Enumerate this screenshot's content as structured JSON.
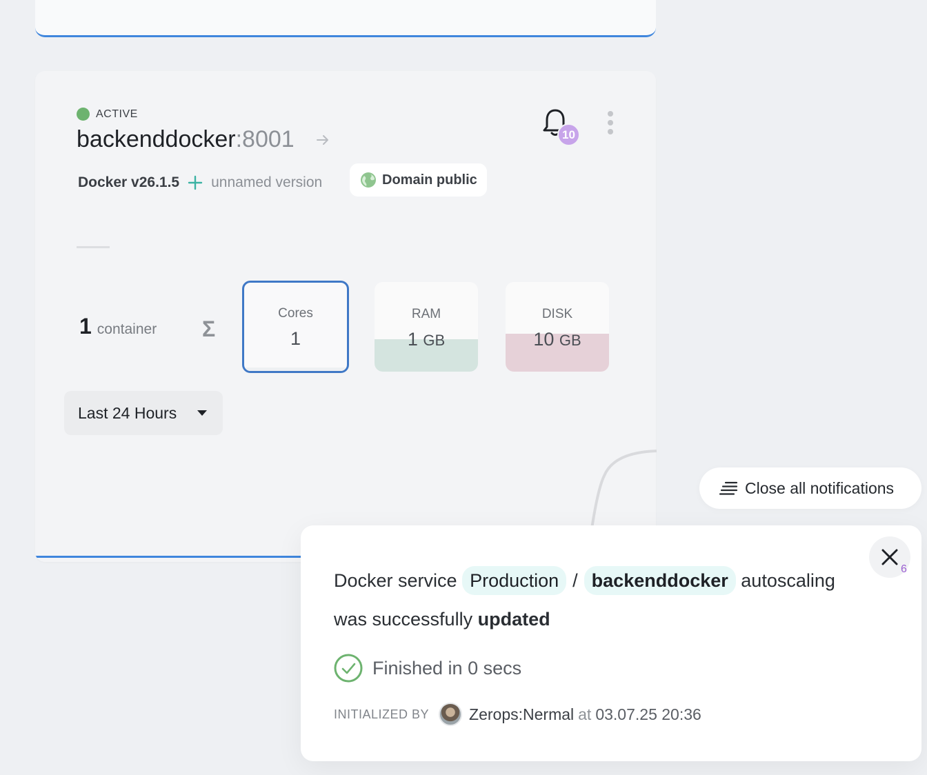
{
  "service": {
    "status": "ACTIVE",
    "name": "backenddocker",
    "port": ":8001",
    "version": "Docker v26.1.5",
    "version_sub": "unnamed version",
    "domain_chip": "Domain public",
    "notifications_count": "10",
    "container_count": "1",
    "container_label": "container",
    "sum_symbol": "Σ"
  },
  "resources": {
    "cores": {
      "label": "Cores",
      "value": "1"
    },
    "ram": {
      "label": "RAM",
      "value": "1",
      "unit": "GB",
      "fill_fraction": 0.36
    },
    "disk": {
      "label": "DISK",
      "value": "10",
      "unit": "GB",
      "fill_fraction": 0.42
    }
  },
  "time_range": {
    "selected": "Last 24 Hours"
  },
  "notifications_bar": {
    "close_all_label": "Close all notifications"
  },
  "notification": {
    "text_prefix": "Docker service",
    "project_tag": "Production",
    "separator": "/",
    "service_tag": "backenddocker",
    "text_middle": "autoscaling",
    "text_line2": "was successfully",
    "text_strong": "updated",
    "finished": "Finished in 0 secs",
    "initialized_label": "INITIALIZED BY",
    "user": "Zerops:Nermal",
    "at_word": "at",
    "timestamp": "03.07.25 20:36",
    "close_count": "6"
  },
  "colors": {
    "accent_blue": "#3f86dd",
    "active_green": "#6db36f",
    "badge_purple": "#c7a4ea",
    "tag_teal": "#e7f8f7"
  },
  "icons": [
    "arrow-right-icon",
    "bell-icon",
    "kebab-menu-icon",
    "plus-icon",
    "globe-icon",
    "sigma-icon",
    "caret-down-icon",
    "lines-icon",
    "close-icon",
    "check-circle-icon",
    "avatar"
  ]
}
